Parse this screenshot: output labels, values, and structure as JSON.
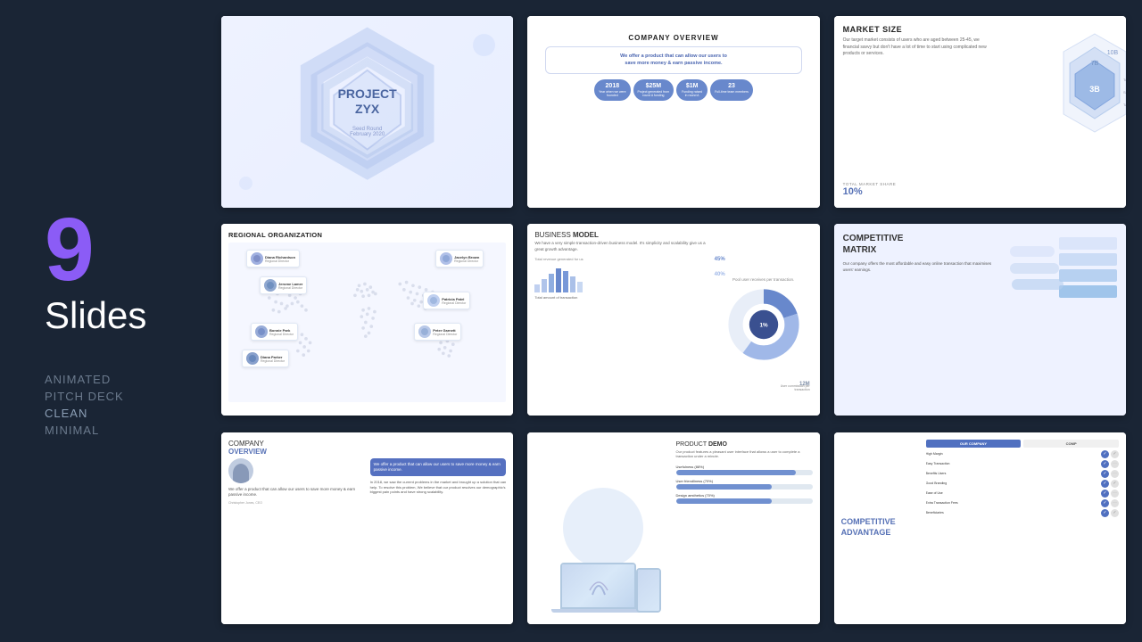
{
  "left": {
    "number": "9",
    "label": "Slides",
    "tags": [
      "ANIMATED",
      "PITCH DECK",
      "CLEAN",
      "MINIMAL"
    ]
  },
  "slides": [
    {
      "id": 1,
      "type": "title",
      "title": "PROJECT\nZYX",
      "subtitle": "Seed Round\nFebruary 2020"
    },
    {
      "id": 2,
      "type": "company-overview",
      "heading": "COMPANY OVERVIEW",
      "tagline": "We offer a product that can allow our users to\nsave more money & earn passive income.",
      "stats": [
        "2018",
        "$25M",
        "$1M",
        "23"
      ],
      "stat_labels": [
        "Year when we were founded",
        "Project generated from round A funding",
        "Funding raised in round A",
        "Full-time team members"
      ]
    },
    {
      "id": 3,
      "type": "market-size",
      "heading": "MARKET SIZE",
      "body": "Our target market consists of users who are aged between 25-45, we financial savvy but don't have a lot of time to start using complicated new products or services.",
      "labels": [
        "10B",
        "7B",
        "3B"
      ],
      "sublabels": [
        "Total Addressable Market",
        "Serviceable Market",
        "Target Market"
      ],
      "market_share_label": "TOTAL MARKET SHARE",
      "market_share_value": "10%"
    },
    {
      "id": 4,
      "type": "regional-organization",
      "heading": "REGIONAL ORGANIZATION",
      "people": [
        {
          "name": "Diana Richardson",
          "role": "Regional Director"
        },
        {
          "name": "Jacelyn Brown",
          "role": "Regional Director"
        },
        {
          "name": "Jerome Lamer",
          "role": "Regional Director"
        },
        {
          "name": "Patricia Patel",
          "role": "Regional Director"
        },
        {
          "name": "Bonnie Park",
          "role": "Regional Director"
        },
        {
          "name": "Peter Garnett",
          "role": "Regional Director"
        },
        {
          "name": "Diana Parker",
          "role": "Regional Director"
        }
      ]
    },
    {
      "id": 5,
      "type": "business-model",
      "heading": "BUSINESS MODEL",
      "heading_bold": "MODEL",
      "body": "We have a very simple transaction-driven business model. It's simplicity and scalability give us a great growth advantage.",
      "right_label": "Pool user receives per transaction.",
      "stats": [
        "45%",
        "40%",
        "12M",
        "1%"
      ],
      "stat_labels": [
        "Total revenue generated for us",
        "",
        "User commission per transaction",
        "Total amount of transaction"
      ]
    },
    {
      "id": 6,
      "type": "competitive-matrix",
      "heading": "COMPETITIVE\nMATRIX",
      "body": "Our company offers the most affordable and easy online transaction that maximises users' earnings."
    },
    {
      "id": 7,
      "type": "company-overview-2",
      "heading": "COMPANY",
      "heading2": "OVERVIEW",
      "tagline": "We offer a product that can allow our users to save more money & earn passive income.",
      "body_quote": "We offer a product that can allow our users to save more money & earn passive income.",
      "extended_body": "In 2018, we saw the current problems in the market and brought up a solution that can help. To resolve this problem, We believe that our product resolves our demographic's biggest pain points and have strong scalability.",
      "author": "Christopher Jones, CEO"
    },
    {
      "id": 8,
      "type": "product-demo",
      "heading": "PRODUCT",
      "heading_bold": "DEMO",
      "body": "Our product features a pleasant user interface that allows a user to complete a transaction under a minute.",
      "bars": [
        {
          "label": "Usefulness (88%)",
          "value": 88
        },
        {
          "label": "User friendliness (70%)",
          "value": 70
        },
        {
          "label": "Design aesthetics (70%)",
          "value": 70
        }
      ]
    },
    {
      "id": 9,
      "type": "competitive-advantage",
      "heading": "COMPETITIVE\nADVANTAGE",
      "our_company": "OUR COMPANY",
      "competitor": "COMP",
      "features": [
        {
          "label": "High Margin",
          "ours": true,
          "theirs": true
        },
        {
          "label": "Easy Transaction",
          "ours": true,
          "theirs": false
        },
        {
          "label": "Benefits Users",
          "ours": true,
          "theirs": false
        },
        {
          "label": "Good Branding",
          "ours": true,
          "theirs": true
        },
        {
          "label": "Ease of Use",
          "ours": true,
          "theirs": false
        },
        {
          "label": "Extra Transaction Fees",
          "ours": true,
          "theirs": false
        },
        {
          "label": "Beneficiaries",
          "ours": true,
          "theirs": true
        }
      ]
    }
  ],
  "colors": {
    "bg": "#1a2535",
    "accent_purple": "#8b5cf6",
    "slide_blue": "#5570b5",
    "text_light": "#ffffff",
    "text_muted": "#6b7a8d"
  }
}
